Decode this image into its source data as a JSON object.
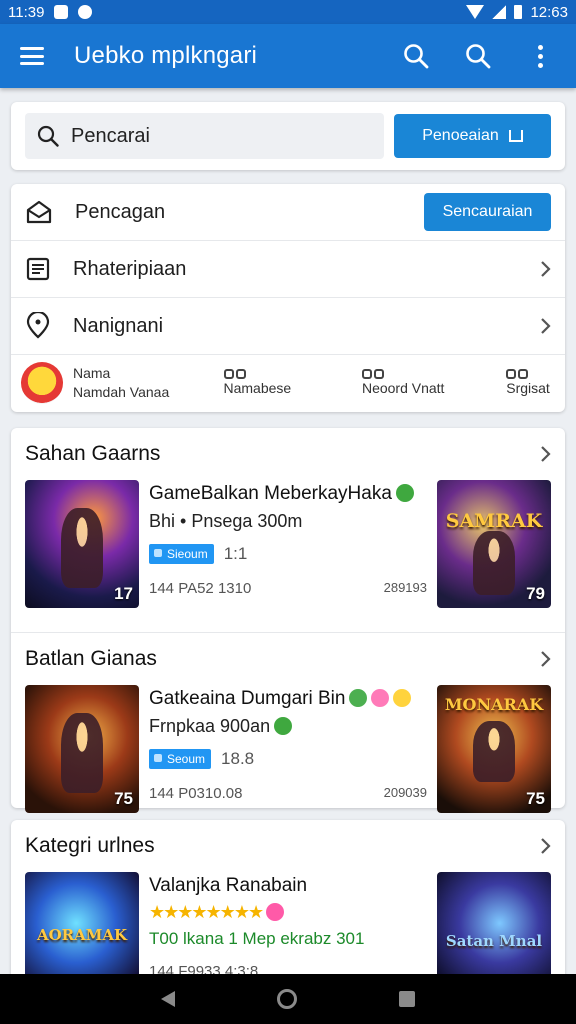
{
  "status_bar": {
    "time": "11:39",
    "right_time": "12:63"
  },
  "app_bar": {
    "title": "Uebko mplkngari"
  },
  "search": {
    "placeholder": "Pencarai",
    "button_label": "Penoeaian"
  },
  "menu": {
    "rows": [
      {
        "label": "Pencagan",
        "button_label": "Sencauraian",
        "icon": "envelope-icon"
      },
      {
        "label": "Rhateripiaan",
        "icon": "list-icon"
      },
      {
        "label": "Nanignani",
        "icon": "location-icon"
      }
    ],
    "mini": [
      {
        "top": "Nama",
        "bottom": "Namdah Vanaa"
      },
      {
        "top": "",
        "bottom": "Namabese"
      },
      {
        "top": "",
        "bottom": "Neoord Vnatt"
      },
      {
        "top": "S",
        "bottom": "Srgisat"
      }
    ]
  },
  "section1": {
    "title": "Sahan Gaarns",
    "game": {
      "title": "GameBalkan MeberkayHaka",
      "sub": "Bhi • Pnsega 300m",
      "badge": "Sieoum",
      "badge_value": "1:1",
      "meta_left": "144 PA52 1310",
      "meta_right": "289193",
      "thumb_left_num": "17",
      "thumb_right_title": "SAMRAK",
      "thumb_right_num": "79"
    }
  },
  "section2": {
    "title": "Batlan Gianas",
    "game": {
      "title": "Gatkeaina Dumgari Bin",
      "sub": "Frnpkaa 900an",
      "badge": "Seoum",
      "badge_value": "18.8",
      "meta_left": "144 P0310.08",
      "meta_right": "209039",
      "thumb_left_num": "75",
      "thumb_right_title": "MONARAK",
      "thumb_right_num": "75"
    }
  },
  "section3": {
    "title": "Kategri urlnes",
    "game": {
      "title": "Valanjka Ranabain",
      "stars": "★★★★★★★★",
      "green": "T00 lkana 1 Mep ekrabz 301",
      "meta_left": "144 F9933 4:3:8",
      "thumb_left_title": "AORAMAK",
      "thumb_right_title": "Satan Mnal"
    }
  },
  "colors": {
    "accent": "#1976d2",
    "button": "#1a86d6",
    "badge": "#2196f3"
  }
}
